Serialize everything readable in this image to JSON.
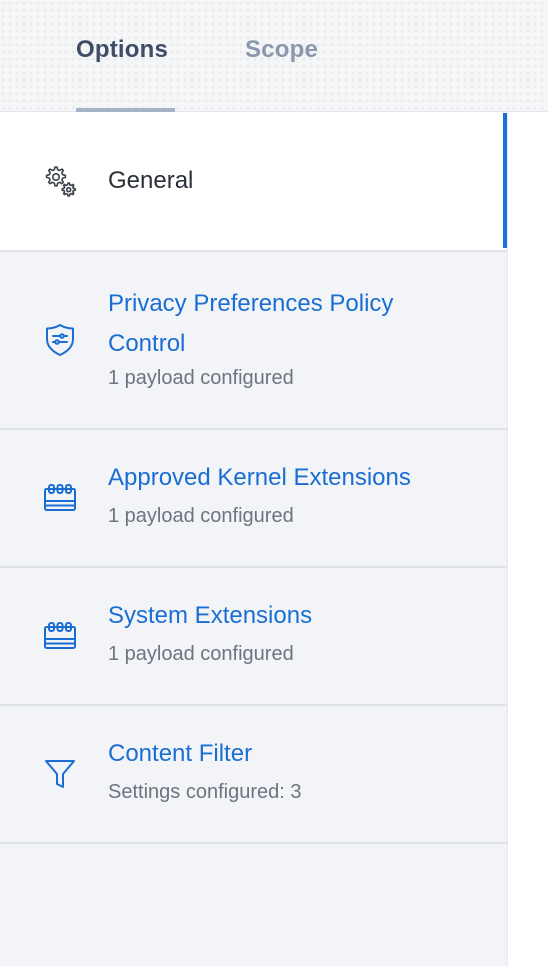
{
  "tabs": {
    "options_label": "Options",
    "scope_label": "Scope"
  },
  "sidebar": {
    "items": [
      {
        "label": "General",
        "icon": "gears-icon"
      },
      {
        "label_line1": "Privacy Preferences Policy",
        "label_line2": "Control",
        "subtitle": "1 payload configured",
        "icon": "shield-icon"
      },
      {
        "label": "Approved Kernel Extensions",
        "subtitle": "1 payload configured",
        "icon": "kernel-extension-icon"
      },
      {
        "label": "System Extensions",
        "subtitle": "1 payload configured",
        "icon": "system-extension-icon"
      },
      {
        "label": "Content Filter",
        "subtitle": "Settings configured: 3",
        "icon": "funnel-icon"
      }
    ]
  },
  "colors": {
    "accent": "#1a6fdb",
    "link": "#1a6ed3",
    "active_tab": "#3e4c66",
    "inactive_tab": "#8a98ad",
    "sidebar_bg": "#f3f4f7"
  }
}
